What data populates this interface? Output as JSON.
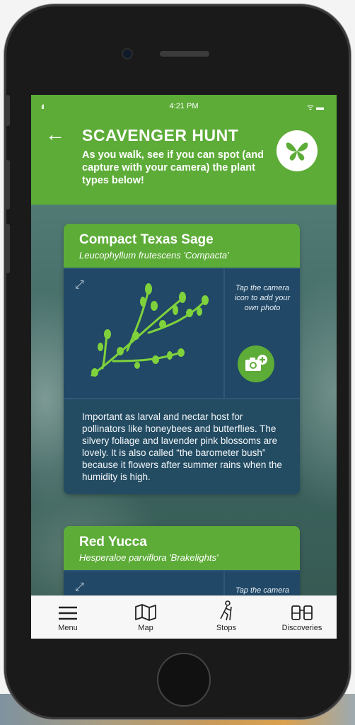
{
  "status_bar": {
    "time": "4:21 PM",
    "signal": "ıll",
    "battery": "ᯤ ▬"
  },
  "header": {
    "back_icon": "arrow-left-icon",
    "title": "SCAVENGER HUNT",
    "subtitle": "As you walk, see if you can spot (and capture with your camera) the plant types below!",
    "logo_icon": "butterfly-icon",
    "color": "#5dac38"
  },
  "cards": [
    {
      "name": "Compact Texas Sage",
      "scientific": "Leucophyllum frutescens 'Compacta'",
      "camera_hint": "Tap the camera icon to add your own photo",
      "description": "Important as larval and nectar host for pollinators like honeybees and butterflies. The silvery foliage and lavender pink blossoms are lovely. It is also called “the barometer bush” because it flowers after summer rains when the humidity is high."
    },
    {
      "name": "Red Yucca",
      "scientific": "Hesperaloe parviflora 'Brakelights'",
      "camera_hint": "Tap the camera icon to add your own photo"
    }
  ],
  "tabbar": {
    "items": [
      {
        "label": "Menu",
        "icon": "menu-icon"
      },
      {
        "label": "Map",
        "icon": "map-icon"
      },
      {
        "label": "Stops",
        "icon": "hiker-icon"
      },
      {
        "label": "Discoveries",
        "icon": "binoculars-icon"
      }
    ]
  },
  "colors": {
    "accent_green": "#5dac38",
    "card_blue": "#214866"
  }
}
